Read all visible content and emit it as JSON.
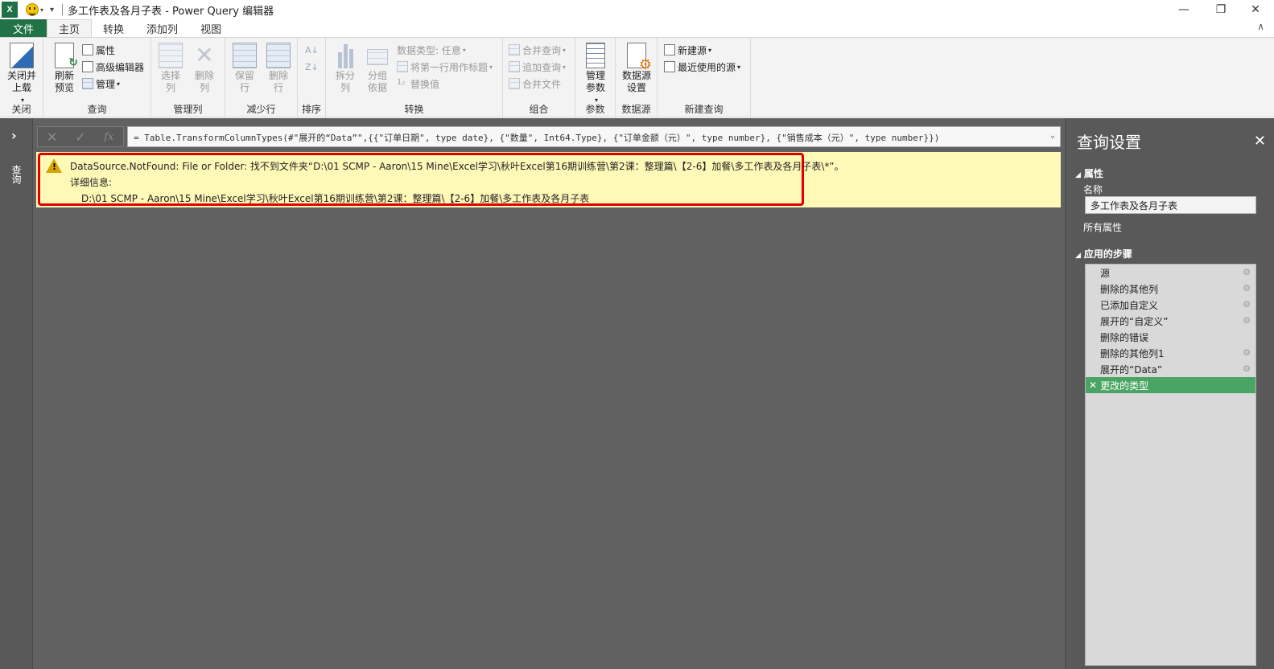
{
  "window": {
    "title": "多工作表及各月子表 - Power Query 编辑器",
    "app_icon": "X",
    "minimize": "—",
    "restore": "❐",
    "close": "✕"
  },
  "tabs": [
    "文件",
    "主页",
    "转换",
    "添加列",
    "视图"
  ],
  "ribbon": {
    "close_group": {
      "label": "关闭",
      "close_load": "关闭并\n上载"
    },
    "query_group": {
      "label": "查询",
      "refresh": "刷新\n预览",
      "properties": "属性",
      "advanced_editor": "高级编辑器",
      "manage": "管理"
    },
    "manage_columns_group": {
      "label": "管理列",
      "choose_columns": "选择\n列",
      "remove_columns": "删除\n列"
    },
    "reduce_rows_group": {
      "label": "减少行",
      "keep_rows": "保留\n行",
      "remove_rows": "删除\n行"
    },
    "sort_group": {
      "label": "排序"
    },
    "transform_group": {
      "label": "转换",
      "split_column": "拆分\n列",
      "group_by": "分组\n依据",
      "data_type": "数据类型: 任意",
      "first_row_header": "将第一行用作标题",
      "replace_values": "替换值"
    },
    "combine_group": {
      "label": "组合",
      "merge_queries": "合并查询",
      "append_queries": "追加查询",
      "combine_files": "合并文件"
    },
    "parameters_group": {
      "label": "参数",
      "manage_parameters": "管理\n参数"
    },
    "datasource_group": {
      "label": "数据源",
      "datasource_settings": "数据源\n设置"
    },
    "new_query_group": {
      "label": "新建查询",
      "new_source": "新建源",
      "recent_sources": "最近使用的源"
    }
  },
  "leftnav": {
    "label": "查询"
  },
  "formula": {
    "cancel": "✕",
    "commit": "✓",
    "fx": "fx",
    "text": "= Table.TransformColumnTypes(#\"展开的“Data”\",{{\"订单日期\", type date}, {\"数量\", Int64.Type}, {\"订单金额（元）\", type number}, {\"销售成本（元）\", type number}})"
  },
  "error": {
    "message": "DataSource.NotFound: File or Folder: 找不到文件夹“D:\\01 SCMP - Aaron\\15 Mine\\Excel学习\\秋叶Excel第16期训练营\\第2课：整理篇\\【2-6】加餐\\多工作表及各月子表\\*”。",
    "details_label": "详细信息:",
    "details_path": "D:\\01 SCMP - Aaron\\15 Mine\\Excel学习\\秋叶Excel第16期训练营\\第2课：整理篇\\【2-6】加餐\\多工作表及各月子表"
  },
  "query_settings": {
    "title": "查询设置",
    "properties_section": "属性",
    "name_label": "名称",
    "name_value": "多工作表及各月子表",
    "all_properties": "所有属性",
    "steps_section": "应用的步骤",
    "steps": [
      {
        "label": "源",
        "gear": true
      },
      {
        "label": "删除的其他列",
        "gear": true
      },
      {
        "label": "已添加自定义",
        "gear": true
      },
      {
        "label": "展开的“自定义”",
        "gear": true
      },
      {
        "label": "删除的错误",
        "gear": false
      },
      {
        "label": "删除的其他列1",
        "gear": true
      },
      {
        "label": "展开的“Data”",
        "gear": true
      },
      {
        "label": "更改的类型",
        "gear": false
      }
    ]
  }
}
